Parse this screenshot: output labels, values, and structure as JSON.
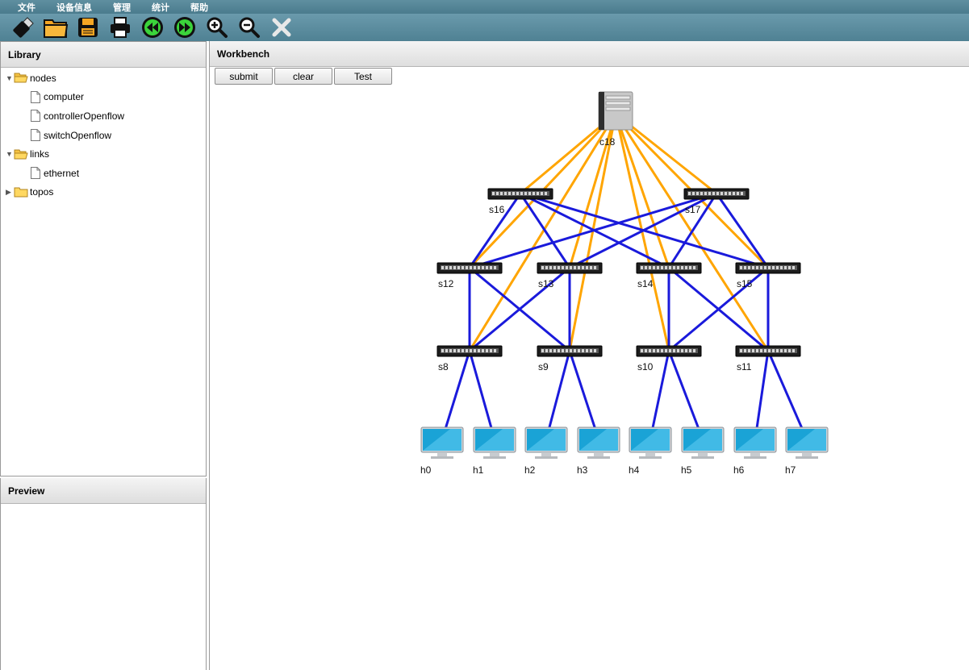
{
  "menubar": [
    "文件",
    "设备信息",
    "管理",
    "统计",
    "帮助"
  ],
  "toolbar": [
    "usb-icon",
    "folder-open-icon",
    "save-icon",
    "print-icon",
    "rewind-icon",
    "fast-forward-icon",
    "zoom-in-icon",
    "zoom-out-icon",
    "close-icon"
  ],
  "library": {
    "title": "Library",
    "tree": [
      {
        "label": "nodes",
        "expanded": true,
        "children": [
          "computer",
          "controllerOpenflow",
          "switchOpenflow"
        ]
      },
      {
        "label": "links",
        "expanded": true,
        "children": [
          "ethernet"
        ]
      },
      {
        "label": "topos",
        "expanded": false,
        "children": []
      }
    ]
  },
  "preview": {
    "title": "Preview"
  },
  "workbench": {
    "title": "Workbench",
    "buttons": {
      "submit": "submit",
      "clear": "clear",
      "test": "Test"
    }
  },
  "colors": {
    "controller_link": "#ffa500",
    "data_link": "#1a1adb"
  },
  "topology": {
    "controller": {
      "id": "c18",
      "label": "c18"
    },
    "core_switches": [
      "s16",
      "s17"
    ],
    "aggregation_switches": [
      "s12",
      "s13",
      "s14",
      "s15"
    ],
    "edge_switches": [
      "s8",
      "s9",
      "s10",
      "s11"
    ],
    "hosts": [
      "h0",
      "h1",
      "h2",
      "h3",
      "h4",
      "h5",
      "h6",
      "h7"
    ],
    "links": [
      [
        "s16",
        "s12"
      ],
      [
        "s16",
        "s13"
      ],
      [
        "s16",
        "s14"
      ],
      [
        "s16",
        "s15"
      ],
      [
        "s17",
        "s12"
      ],
      [
        "s17",
        "s13"
      ],
      [
        "s17",
        "s14"
      ],
      [
        "s17",
        "s15"
      ],
      [
        "s12",
        "s8"
      ],
      [
        "s12",
        "s9"
      ],
      [
        "s13",
        "s8"
      ],
      [
        "s13",
        "s9"
      ],
      [
        "s14",
        "s10"
      ],
      [
        "s14",
        "s11"
      ],
      [
        "s15",
        "s10"
      ],
      [
        "s15",
        "s11"
      ],
      [
        "s8",
        "h0"
      ],
      [
        "s8",
        "h1"
      ],
      [
        "s9",
        "h2"
      ],
      [
        "s9",
        "h3"
      ],
      [
        "s10",
        "h4"
      ],
      [
        "s10",
        "h5"
      ],
      [
        "s11",
        "h6"
      ],
      [
        "s11",
        "h7"
      ]
    ],
    "controller_links": [
      "s16",
      "s17",
      "s12",
      "s13",
      "s14",
      "s15",
      "s8",
      "s9",
      "s10",
      "s11"
    ]
  }
}
